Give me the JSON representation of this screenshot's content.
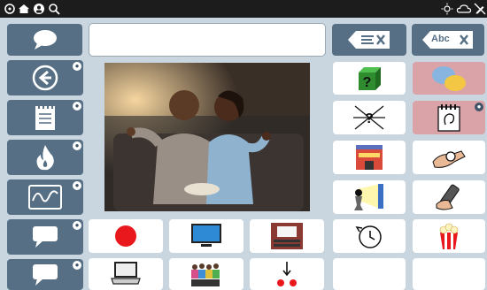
{
  "topbar": {
    "left_icons": [
      "settings-icon",
      "home-icon",
      "user-icon",
      "search-icon"
    ],
    "right_icons": [
      "brightness-icon",
      "cloud-sync-icon",
      "no-edit-icon"
    ]
  },
  "toolbar": {
    "speak_icon": "speech-bubble-icon",
    "clear_word_icon": "delete-word-icon",
    "clear_all_label": "Abc"
  },
  "message_window": {
    "value": ""
  },
  "sidebar": {
    "items": [
      {
        "name": "back",
        "icon": "back-arrow-icon"
      },
      {
        "name": "notes",
        "icon": "notepad-icon"
      },
      {
        "name": "hot",
        "icon": "flame-icon"
      },
      {
        "name": "signal",
        "icon": "waveform-icon"
      },
      {
        "name": "chat-1",
        "icon": "speech-bubble-icon"
      },
      {
        "name": "chat-2",
        "icon": "speech-bubble-icon"
      }
    ]
  },
  "photo": {
    "subject": "couple-watching-tv"
  },
  "grid": {
    "cells": [
      {
        "icon": "question-box-icon"
      },
      {
        "icon": "conversation-icon"
      },
      {
        "icon": "confused-person-icon"
      },
      {
        "icon": "notepad-ear-icon"
      },
      {
        "icon": "theater-building-icon"
      },
      {
        "icon": "wristwatch-hand-icon"
      },
      {
        "icon": "projector-viewer-icon"
      },
      {
        "icon": "remote-control-icon"
      },
      {
        "icon": "record-dot-icon"
      },
      {
        "icon": "television-icon"
      },
      {
        "icon": "movie-screen-icon"
      },
      {
        "icon": "clock-rewind-icon"
      },
      {
        "icon": "popcorn-icon"
      },
      {
        "icon": "laptop-icon"
      },
      {
        "icon": "audience-icon"
      },
      {
        "icon": "dots-arrow-icon"
      },
      {
        "icon": "empty"
      },
      {
        "icon": "empty"
      }
    ]
  },
  "colors": {
    "button": "#566f85",
    "background": "#c9d6e0",
    "pink_cell": "#d9a3a8"
  }
}
